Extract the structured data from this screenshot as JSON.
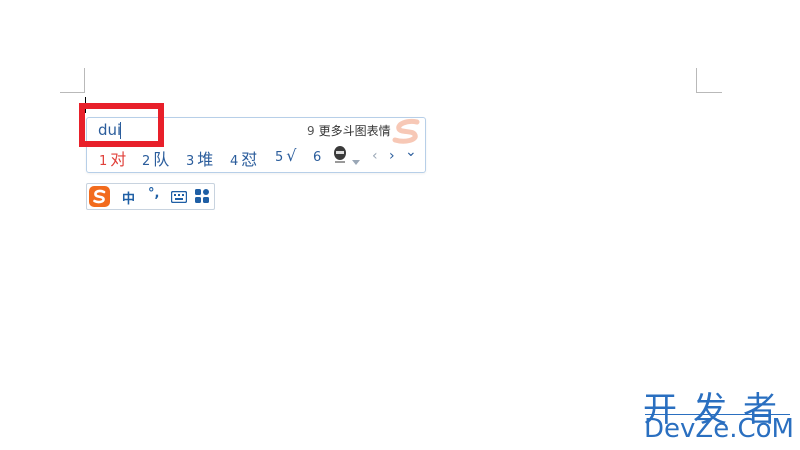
{
  "ime": {
    "composition": "dui",
    "more_number": "9",
    "more_label": "更多斗图表情",
    "candidates": [
      {
        "num": "1",
        "text": "对"
      },
      {
        "num": "2",
        "text": "队"
      },
      {
        "num": "3",
        "text": "堆"
      },
      {
        "num": "4",
        "text": "怼"
      },
      {
        "num": "5",
        "text": "√"
      },
      {
        "num": "6",
        "text": ""
      }
    ],
    "prev_icon": "‹",
    "next_icon": "›",
    "expand_icon": "⌄"
  },
  "status_bar": {
    "mode": "中",
    "punct": "°,",
    "logo_icon": "sogou-s-logo",
    "keyboard_icon": "keyboard-icon",
    "grid_icon": "toolbox-grid-icon"
  },
  "watermark": {
    "top": "开发者",
    "bottom": "DevZe.CoM"
  },
  "colors": {
    "highlight": "#e8202a",
    "ime_text": "#2b5d9c",
    "active_candidate": "#e0403a",
    "watermark": "#2a6fc0"
  }
}
